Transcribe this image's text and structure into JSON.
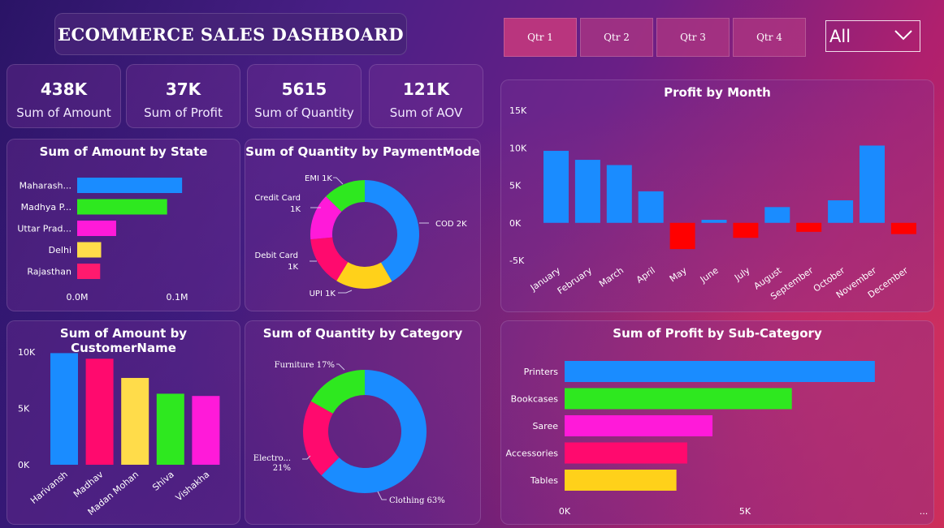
{
  "title": "ECOMMERCE SALES DASHBOARD",
  "slicer": {
    "quarters": [
      "Qtr 1",
      "Qtr 2",
      "Qtr 3",
      "Qtr 4"
    ],
    "dropdown_value": "All",
    "dropdown_icon": "chevron-down-icon"
  },
  "kpis": [
    {
      "value": "438K",
      "label": "Sum of Amount"
    },
    {
      "value": "37K",
      "label": "Sum of Profit"
    },
    {
      "value": "5615",
      "label": "Sum of Quantity"
    },
    {
      "value": "121K",
      "label": "Sum of AOV"
    }
  ],
  "colors": {
    "blue": "#1a8cff",
    "green": "#2ee81f",
    "magenta": "#ff1ad9",
    "yellow": "#ffd11a",
    "pink": "#ff0a6e",
    "red": "#ff0000",
    "light_yellow": "#ffdc4a",
    "light_pink": "#ff1a95"
  },
  "chart_data": [
    {
      "id": "amount-by-state",
      "type": "bar",
      "orientation": "horizontal",
      "title": "Sum of Amount by State",
      "categories": [
        "Maharash...",
        "Madhya P...",
        "Uttar Prad...",
        "Delhi",
        "Rajasthan"
      ],
      "values": [
        105000,
        90000,
        39000,
        24000,
        23000
      ],
      "colors": [
        "#1a8cff",
        "#2ee81f",
        "#ff1ad9",
        "#ffdc4a",
        "#ff1a6e"
      ],
      "xticks": [
        "0.0M",
        "0.1M"
      ],
      "xlim": [
        0,
        100000
      ]
    },
    {
      "id": "quantity-by-paymentmode",
      "type": "pie",
      "donut": true,
      "title": "Sum of Quantity by PaymentMode",
      "slices": [
        {
          "label": "COD 2K",
          "value": 2300,
          "color": "#1a8cff"
        },
        {
          "label": "UPI 1K",
          "value": 940,
          "color": "#ffd11a"
        },
        {
          "label": "Debit Card 1K",
          "value": 820,
          "color": "#ff0a6e"
        },
        {
          "label": "Credit Card 1K",
          "value": 760,
          "color": "#ff1ad9"
        },
        {
          "label": "EMI 1K",
          "value": 700,
          "color": "#2ee81f"
        }
      ]
    },
    {
      "id": "profit-by-month",
      "type": "bar",
      "title": "Profit by Month",
      "categories": [
        "January",
        "February",
        "March",
        "April",
        "May",
        "June",
        "July",
        "August",
        "September",
        "October",
        "November",
        "December"
      ],
      "values": [
        9600,
        8400,
        7700,
        4200,
        -3500,
        400,
        -2000,
        2100,
        -1200,
        3000,
        10300,
        -1500
      ],
      "positive_color": "#1a8cff",
      "negative_color": "#ff0000",
      "yticks": [
        "15K",
        "10K",
        "5K",
        "0K",
        "-5K"
      ],
      "ylim": [
        -5000,
        15000
      ]
    },
    {
      "id": "amount-by-customername",
      "type": "bar",
      "title": "Sum of Amount by CustomerName",
      "categories": [
        "Harivansh",
        "Madhav",
        "Madan Mohan",
        "Shiva",
        "Vishakha"
      ],
      "values": [
        9900,
        9400,
        7700,
        6300,
        6100
      ],
      "colors": [
        "#1a8cff",
        "#ff0a6e",
        "#ffdc4a",
        "#2ee81f",
        "#ff1ad9"
      ],
      "yticks": [
        "10K",
        "5K",
        "0K"
      ],
      "ylim": [
        0,
        10000
      ]
    },
    {
      "id": "quantity-by-category",
      "type": "pie",
      "donut": true,
      "title": "Sum of Quantity by Category",
      "slices": [
        {
          "label": "Clothing 63%",
          "value": 63,
          "color": "#1a8cff"
        },
        {
          "label_line1": "Electro...",
          "label_line2": "21%",
          "value": 21,
          "color": "#ff0a6e"
        },
        {
          "label": "Furniture 17%",
          "value": 17,
          "color": "#2ee81f"
        }
      ]
    },
    {
      "id": "profit-by-subcategory",
      "type": "bar",
      "orientation": "horizontal",
      "title": "Sum of Profit by Sub-Category",
      "categories": [
        "Printers",
        "Bookcases",
        "Saree",
        "Accessories",
        "Tables"
      ],
      "values": [
        8600,
        6300,
        4100,
        3400,
        3100
      ],
      "colors": [
        "#1a8cff",
        "#2ee81f",
        "#ff1ad9",
        "#ff0a6e",
        "#ffd11a"
      ],
      "xticks": [
        "0K",
        "5K"
      ],
      "xlim": [
        0,
        5000
      ],
      "more_indicator": "..."
    }
  ]
}
